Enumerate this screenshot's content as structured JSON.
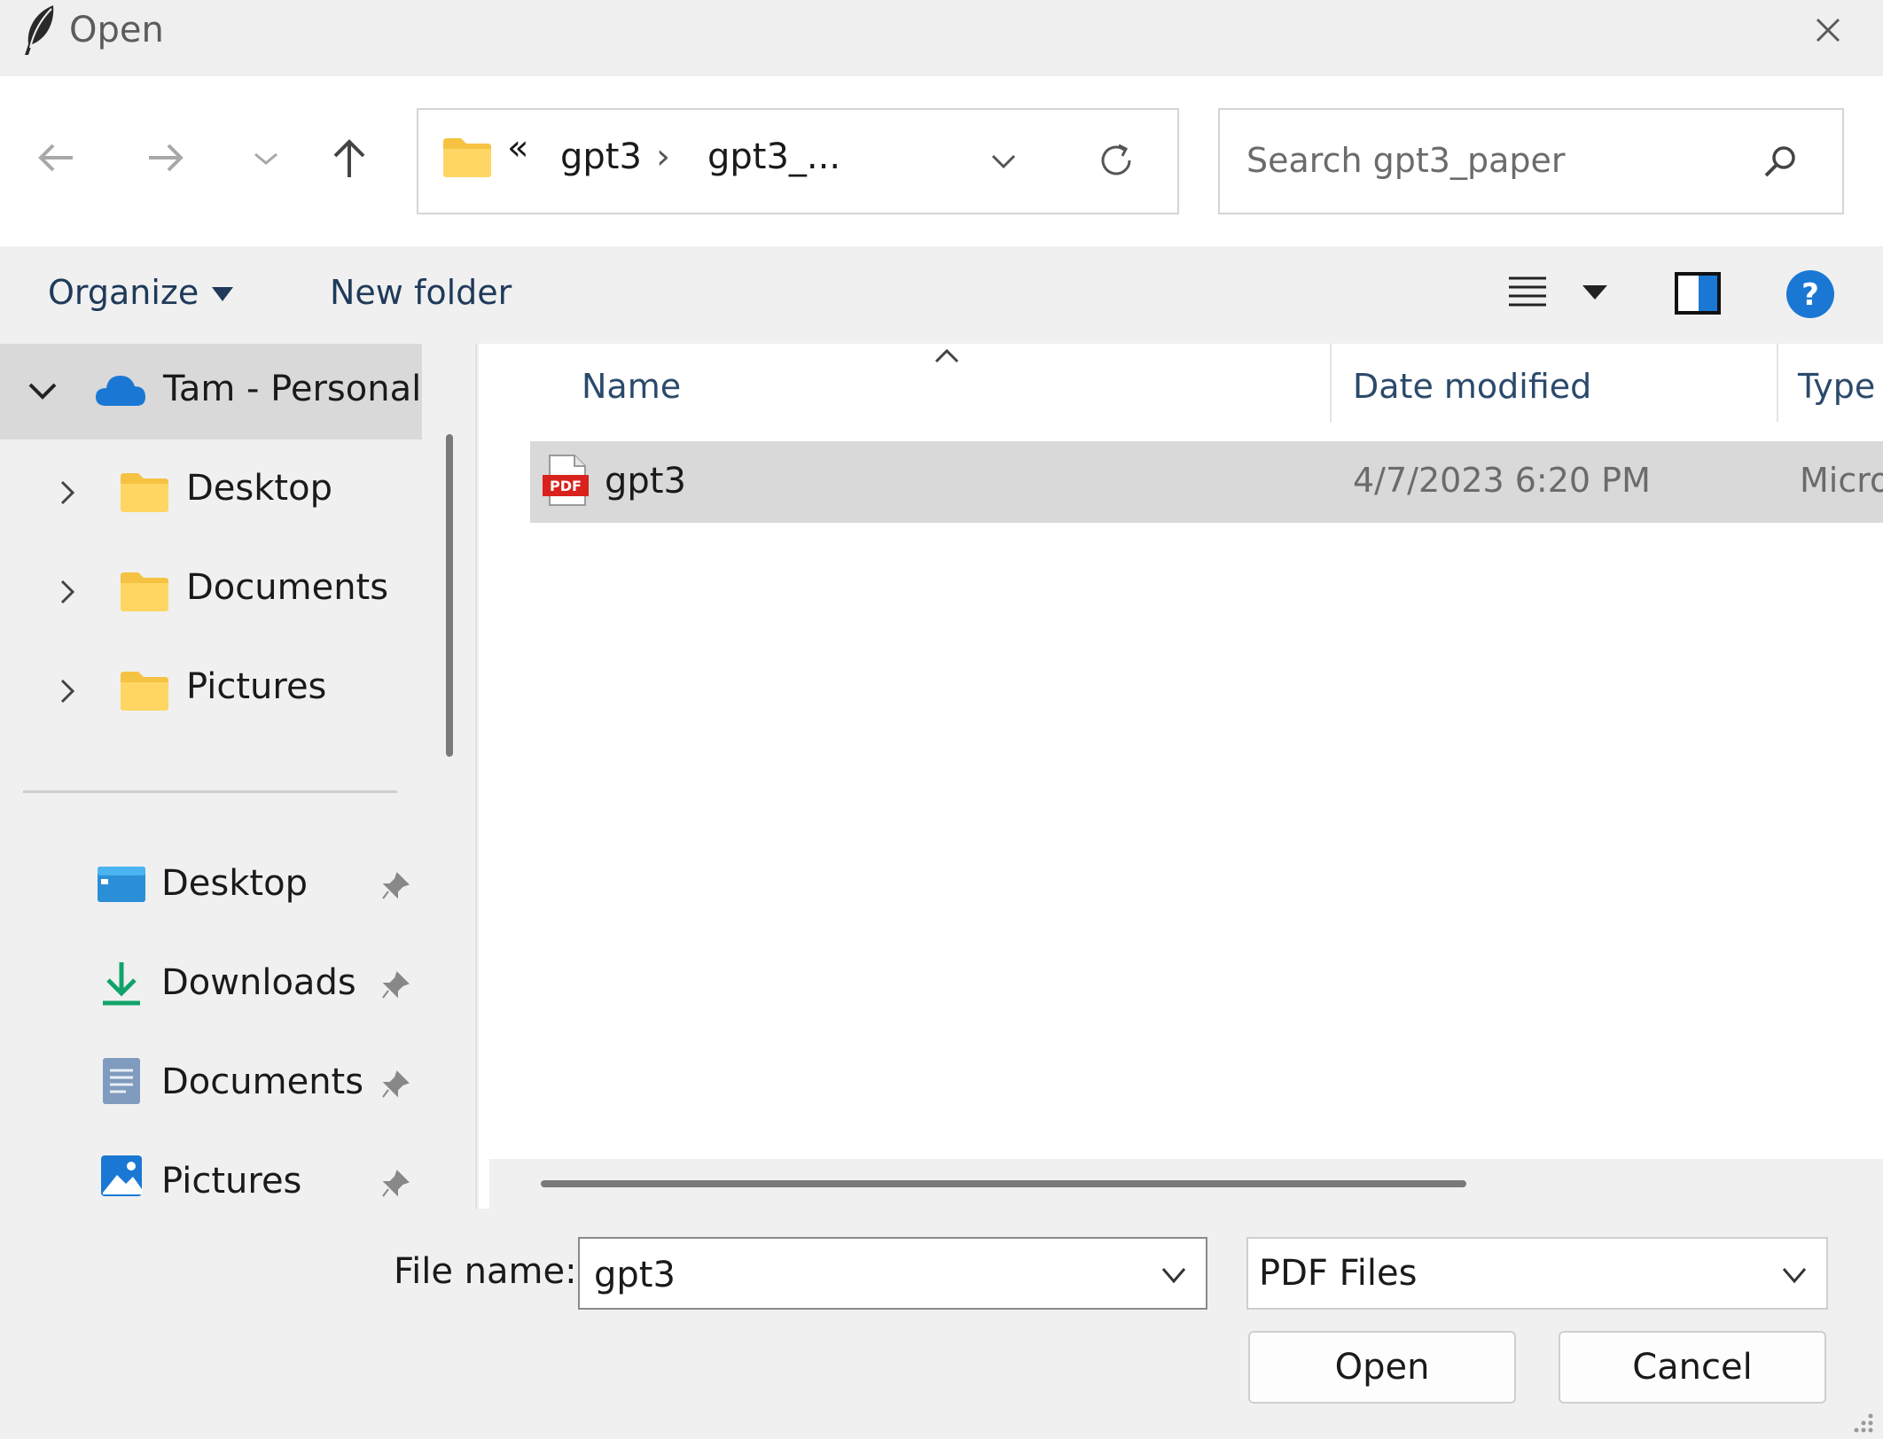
{
  "window": {
    "title": "Open"
  },
  "address_bar": {
    "overflow_glyph": "«",
    "crumbs": [
      "gpt3",
      "gpt3_..."
    ],
    "separator": "›"
  },
  "search": {
    "placeholder": "Search gpt3_paper"
  },
  "toolbar": {
    "organize_label": "Organize",
    "new_folder_label": "New folder"
  },
  "nav_pane": {
    "root": {
      "label": "Tam - Personal",
      "icon": "onedrive-cloud-icon"
    },
    "tree_items": [
      {
        "label": "Desktop",
        "icon": "folder-icon"
      },
      {
        "label": "Documents",
        "icon": "folder-icon"
      },
      {
        "label": "Pictures",
        "icon": "folder-icon"
      }
    ],
    "quick_access": [
      {
        "label": "Desktop",
        "icon": "desktop-icon"
      },
      {
        "label": "Downloads",
        "icon": "download-icon"
      },
      {
        "label": "Documents",
        "icon": "documents-icon"
      },
      {
        "label": "Pictures",
        "icon": "pictures-icon"
      }
    ]
  },
  "file_list": {
    "columns": [
      "Name",
      "Date modified",
      "Type"
    ],
    "rows": [
      {
        "name": "gpt3",
        "date_modified": "4/7/2023 6:20 PM",
        "type": "Micro",
        "icon": "pdf-file-icon"
      }
    ]
  },
  "footer": {
    "filename_label": "File name:",
    "filename_value": "gpt3",
    "filetype_value": "PDF Files",
    "open_label": "Open",
    "cancel_label": "Cancel"
  },
  "colors": {
    "accent_blue": "#0067c0",
    "folder_yellow": "#f5c242",
    "selection_gray": "#d9d9d9",
    "pdf_red": "#d9221c"
  }
}
